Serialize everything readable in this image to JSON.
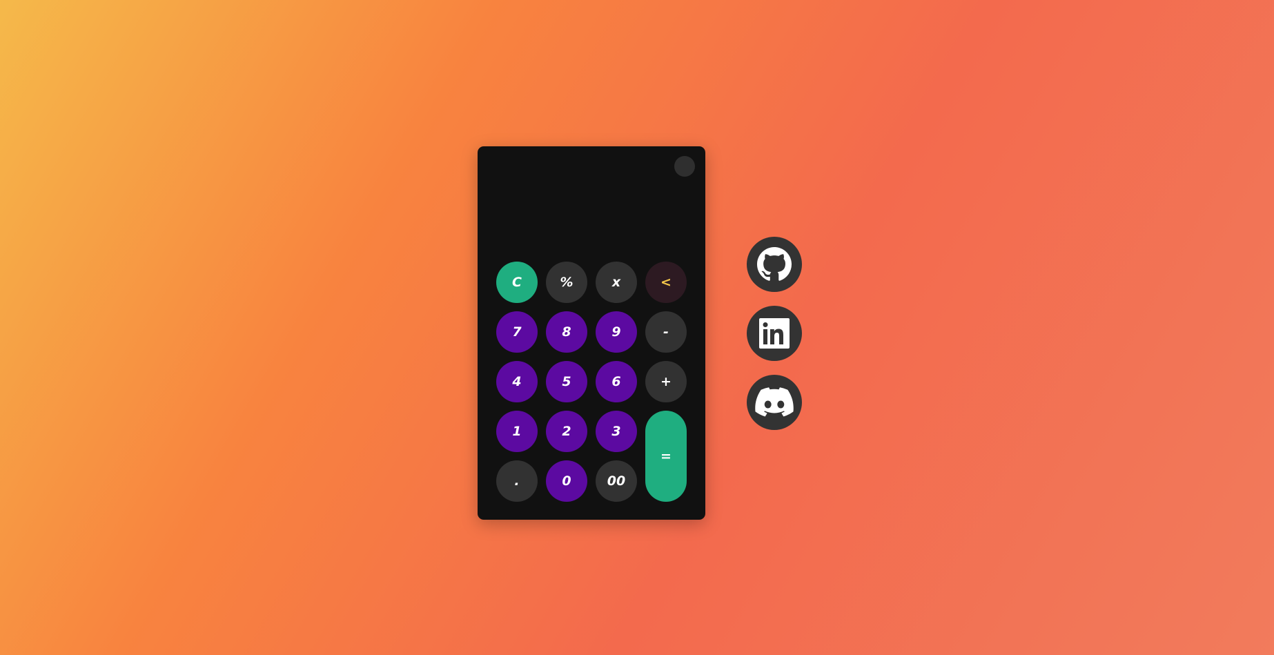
{
  "calculator": {
    "display_value": "",
    "keys": [
      {
        "label": "C",
        "style": "green",
        "name": "clear-button"
      },
      {
        "label": "%",
        "style": "gray",
        "name": "percent-button"
      },
      {
        "label": "x",
        "style": "gray",
        "name": "multiply-button"
      },
      {
        "label": "<",
        "style": "back",
        "name": "backspace-button"
      },
      {
        "label": "7",
        "style": "purple",
        "name": "digit-7-button"
      },
      {
        "label": "8",
        "style": "purple",
        "name": "digit-8-button"
      },
      {
        "label": "9",
        "style": "purple",
        "name": "digit-9-button"
      },
      {
        "label": "-",
        "style": "gray",
        "name": "subtract-button"
      },
      {
        "label": "4",
        "style": "purple",
        "name": "digit-4-button"
      },
      {
        "label": "5",
        "style": "purple",
        "name": "digit-5-button"
      },
      {
        "label": "6",
        "style": "purple",
        "name": "digit-6-button"
      },
      {
        "label": "+",
        "style": "gray",
        "name": "add-button"
      },
      {
        "label": "1",
        "style": "purple",
        "name": "digit-1-button"
      },
      {
        "label": "2",
        "style": "purple",
        "name": "digit-2-button"
      },
      {
        "label": "3",
        "style": "purple",
        "name": "digit-3-button"
      },
      {
        "label": "=",
        "style": "green equals",
        "name": "equals-button"
      },
      {
        "label": ".",
        "style": "gray",
        "name": "decimal-button"
      },
      {
        "label": "0",
        "style": "purple",
        "name": "digit-0-button"
      },
      {
        "label": "00",
        "style": "gray",
        "name": "double-zero-button"
      }
    ]
  },
  "socials": [
    {
      "icon": "github-icon"
    },
    {
      "icon": "linkedin-icon"
    },
    {
      "icon": "discord-icon"
    }
  ],
  "colors": {
    "accent_green": "#1fae80",
    "digit_purple": "#5c0aa1",
    "operator_gray": "#323232",
    "backspace_bg": "#2d1a22",
    "backspace_fg": "#f3c74a",
    "calculator_bg": "#111111"
  }
}
